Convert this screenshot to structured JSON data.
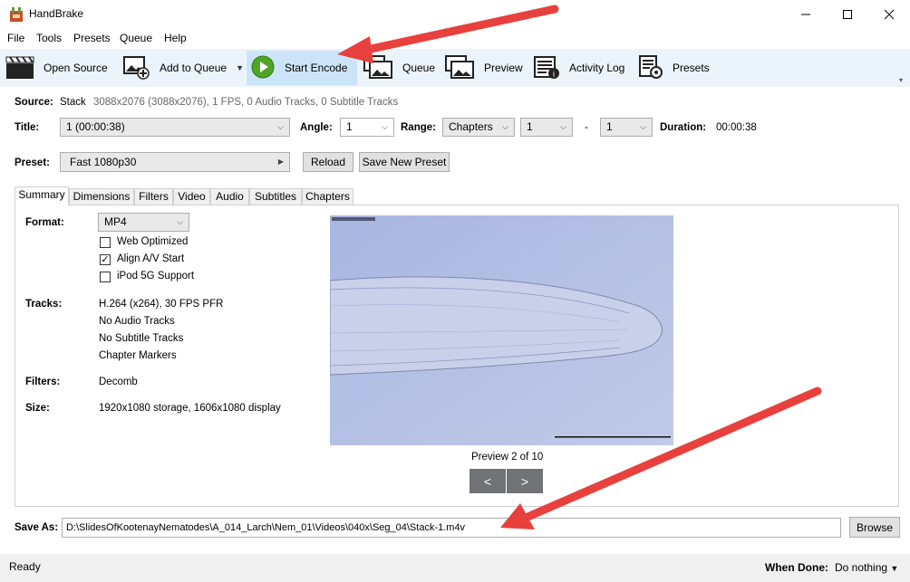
{
  "window": {
    "title": "HandBrake"
  },
  "menu": [
    "File",
    "Tools",
    "Presets",
    "Queue",
    "Help"
  ],
  "toolbar": {
    "open_source": "Open Source",
    "add_to_queue": "Add to Queue",
    "start_encode": "Start Encode",
    "queue": "Queue",
    "preview": "Preview",
    "activity_log": "Activity Log",
    "presets": "Presets"
  },
  "source": {
    "label": "Source:",
    "name": "Stack",
    "details": "3088x2076 (3088x2076), 1 FPS, 0 Audio Tracks, 0 Subtitle Tracks"
  },
  "title_row": {
    "title_label": "Title:",
    "title_value": "1  (00:00:38)",
    "angle_label": "Angle:",
    "angle_value": "1",
    "range_label": "Range:",
    "range_type": "Chapters",
    "range_start": "1",
    "range_dash": "-",
    "range_end": "1",
    "duration_label": "Duration:",
    "duration_value": "00:00:38"
  },
  "preset": {
    "label": "Preset:",
    "value": "Fast 1080p30",
    "reload": "Reload",
    "save_new": "Save New Preset"
  },
  "tabs": [
    "Summary",
    "Dimensions",
    "Filters",
    "Video",
    "Audio",
    "Subtitles",
    "Chapters"
  ],
  "summary": {
    "format_label": "Format:",
    "format_value": "MP4",
    "web_optimized": "Web Optimized",
    "web_optimized_checked": false,
    "align_av": "Align A/V Start",
    "align_av_checked": true,
    "ipod": "iPod 5G Support",
    "ipod_checked": false,
    "tracks_label": "Tracks:",
    "tracks": [
      "H.264 (x264), 30 FPS PFR",
      "No Audio Tracks",
      "No Subtitle Tracks",
      "Chapter Markers"
    ],
    "filters_label": "Filters:",
    "filters_value": "Decomb",
    "size_label": "Size:",
    "size_value": "1920x1080 storage, 1606x1080 display",
    "preview_caption": "Preview 2 of 10",
    "prev": "<",
    "next": ">"
  },
  "save_as": {
    "label": "Save As:",
    "path": "D:\\SlidesOfKootenayNematodes\\A_014_Larch\\Nem_01\\Videos\\040x\\Seg_04\\Stack-1.m4v",
    "browse": "Browse"
  },
  "status": {
    "text": "Ready",
    "when_done_label": "When Done:",
    "when_done_value": "Do nothing"
  },
  "colors": {
    "toolbar_bg": "#ebf3fb",
    "highlight": "#cce4f7",
    "arrow": "#e8403c",
    "preview_bg": "#b7c3e3"
  }
}
